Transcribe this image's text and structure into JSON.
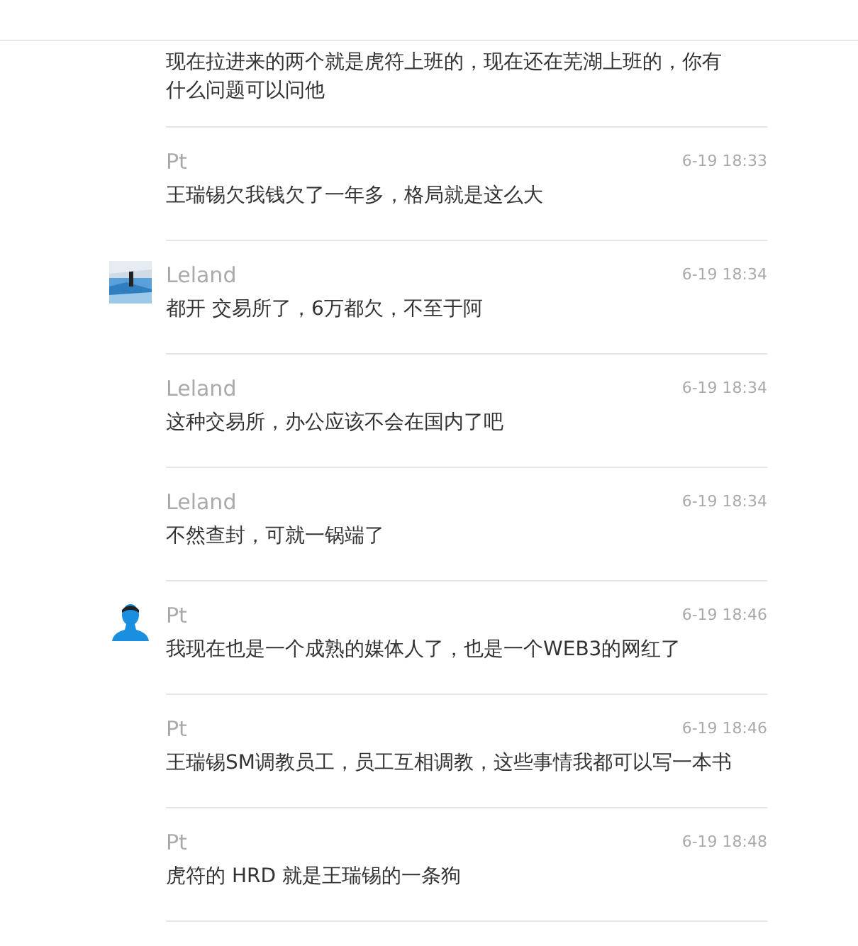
{
  "messages": [
    {
      "text": "现在拉进来的两个就是虎符上班的，现在还在芜湖上班的，你有什么问题可以问他",
      "kind": "continued"
    },
    {
      "name": "Pt",
      "time": "6-19 18:33",
      "text": "王瑞锡欠我钱欠了一年多，格局就是这么大",
      "kind": "plain"
    },
    {
      "name": "Leland",
      "time": "6-19 18:34",
      "text": "都开 交易所了，6万都欠，不至于阿"
    },
    {
      "name": "Leland",
      "time": "6-19 18:34",
      "text": "这种交易所，办公应该不会在国内了吧",
      "kind": "plain"
    },
    {
      "name": "Leland",
      "time": "6-19 18:34",
      "text": "不然查封，可就一锅端了",
      "kind": "plain"
    },
    {
      "name": "Pt",
      "time": "6-19 18:46",
      "text": "我现在也是一个成熟的媒体人了，也是一个WEB3的网红了",
      "kind": "silhouette"
    },
    {
      "name": "Pt",
      "time": "6-19 18:46",
      "text": "王瑞锡SM调教员工，员工互相调教，这些事情我都可以写一本书",
      "kind": "plain"
    },
    {
      "name": "Pt",
      "time": "6-19 18:48",
      "text": "虎符的 HRD 就是王瑞锡的一条狗",
      "kind": "plain"
    }
  ]
}
